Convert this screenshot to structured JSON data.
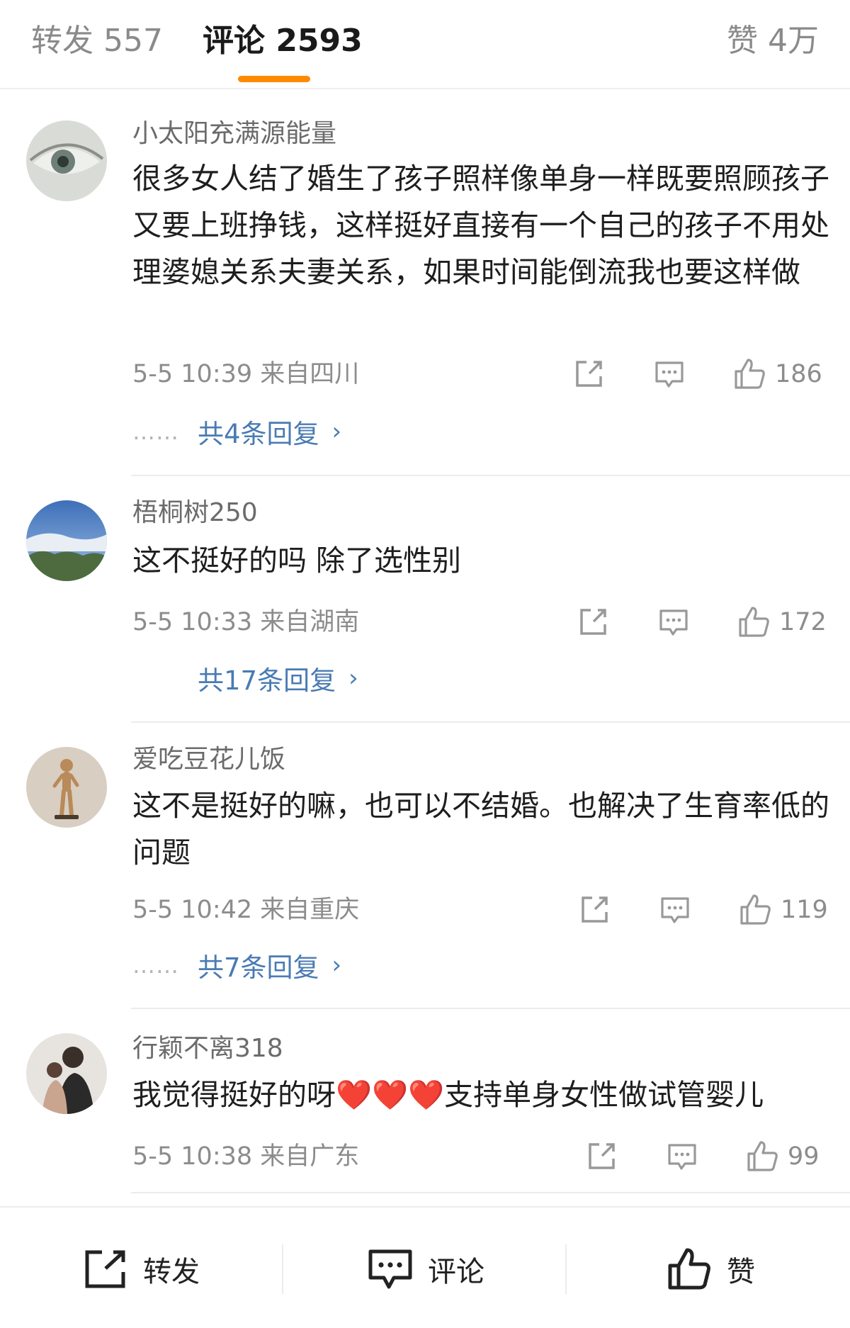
{
  "tabs": {
    "repost": "转发 557",
    "comment": "评论 2593",
    "like": "赞 4万"
  },
  "comments": [
    {
      "username": "小太阳充满源能量",
      "text": "很多女人结了婚生了孩子照样像单身一样既要照顾孩子又要上班挣钱，这样挺好直接有一个自己的孩子不用处理婆媳关系夫妻关系，如果时间能倒流我也要这样做",
      "meta": "5-5 10:39  来自四川",
      "likes": "186",
      "replies": "共4条回复"
    },
    {
      "username": "梧桐树250",
      "text": "这不挺好的吗  除了选性别",
      "meta": "5-5 10:33  来自湖南",
      "likes": "172",
      "replies": "共17条回复"
    },
    {
      "username": "爱吃豆花儿饭",
      "text": "这不是挺好的嘛，也可以不结婚。也解决了生育率低的问题",
      "meta": "5-5 10:42  来自重庆",
      "likes": "119",
      "replies": "共7条回复"
    },
    {
      "username": "行颖不离318",
      "text": "我觉得挺好的呀❤️❤️❤️支持单身女性做试管婴儿",
      "meta": "5-5 10:38  来自广东",
      "likes": "99"
    }
  ],
  "reply_dots": "……",
  "reply_chevron": "›",
  "bottom_bar": {
    "repost": "转发",
    "comment": "评论",
    "like": "赞"
  },
  "icons": [
    "share-icon",
    "comment-icon",
    "thumbs-up-icon",
    "chevron-right-icon"
  ],
  "colors": {
    "accent": "#ff8a00",
    "link": "#4a7bb3",
    "meta": "#8c8c8c"
  }
}
